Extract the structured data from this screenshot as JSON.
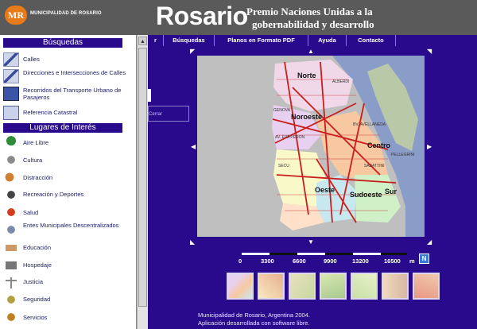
{
  "header": {
    "logo": "MR",
    "municipality": "MUNICIPALIDAD DE ROSARIO",
    "city": "Rosario",
    "prize_line1": "Premio Naciones Unidas a la",
    "prize_line2": "gobernabilidad y desarrollo",
    "colors": {
      "bar": "#5a5a5a",
      "logo": "#e87a1a"
    }
  },
  "sidebar": {
    "busquedas_title": "Búsquedas",
    "busquedas": [
      {
        "label": "Calles",
        "icon": "street-sign-icon"
      },
      {
        "label": "Direcciones e Intersecciones de Calles",
        "icon": "intersection-icon"
      },
      {
        "label": "Recorridos del Transporte Urbano de Pasajeros",
        "icon": "bus-route-icon"
      },
      {
        "label": "Referencia Catastral",
        "icon": "cadastre-icon"
      }
    ],
    "lugares_title": "Lugares de Interés",
    "lugares": [
      {
        "label": "Aire Libre",
        "icon": "tree-icon"
      },
      {
        "label": "Cultura",
        "icon": "culture-icon"
      },
      {
        "label": "Distracción",
        "icon": "entertainment-icon"
      },
      {
        "label": "Recreación y Deportes",
        "icon": "ball-icon"
      },
      {
        "label": "Salud",
        "icon": "health-icon"
      },
      {
        "label": "Entes Municipales Descentralizados",
        "icon": "municipal-building-icon"
      },
      {
        "label": "Educación",
        "icon": "education-icon"
      },
      {
        "label": "Hospedaje",
        "icon": "lodging-icon"
      },
      {
        "label": "Justicia",
        "icon": "justice-icon"
      },
      {
        "label": "Seguridad",
        "icon": "security-icon"
      },
      {
        "label": "Servicios",
        "icon": "services-icon"
      }
    ]
  },
  "menu": {
    "partial": "r",
    "items": [
      "Búsquedas",
      "Planos en Formato PDF",
      "Ayuda",
      "Contacto"
    ]
  },
  "overlay_text": "Cerrar",
  "map": {
    "labels": [
      "Norte",
      "Noroeste",
      "Centro",
      "Oeste",
      "Sudoeste",
      "Sur"
    ],
    "streets": [
      "GENOVA",
      "AV. EVA PERON",
      "BV. AVELLANEDA",
      "SABATTINI",
      "PELLEGRINI",
      "ALBERDI",
      "SECU"
    ],
    "colors": {
      "water": "#8a9cc8",
      "land": "#e8d8c0",
      "roads": "#c81e1e"
    }
  },
  "scale": {
    "ticks": [
      "0",
      "3300",
      "6600",
      "9900",
      "13200",
      "16500"
    ],
    "unit": "m",
    "north": "N"
  },
  "thumbnails": [
    "thumb-1",
    "thumb-2",
    "thumb-3",
    "thumb-4",
    "thumb-5",
    "thumb-6",
    "thumb-7"
  ],
  "footer": {
    "line1": "Municipalidad de Rosario, Argentina 2004.",
    "line2": "Aplicación desarrollada con software libre."
  }
}
